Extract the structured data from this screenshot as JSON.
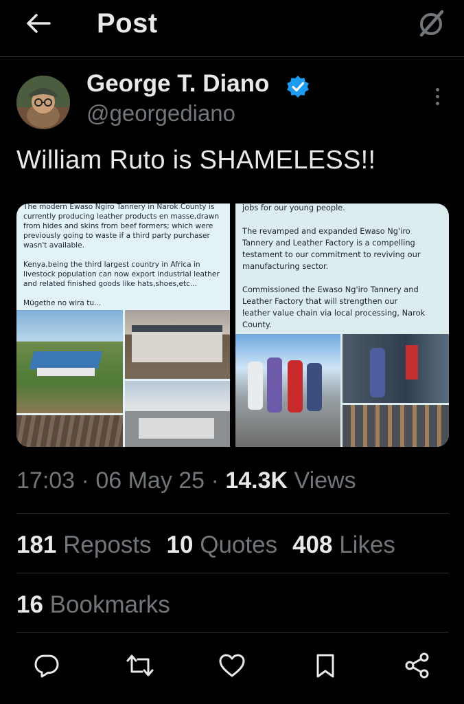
{
  "header": {
    "title": "Post"
  },
  "author": {
    "name": "George T. Diano",
    "handle": "@georgediano"
  },
  "tweet": {
    "text": "William Ruto is SHAMELESS!!"
  },
  "media": {
    "left_text": [
      "The modern Ewaso Ngiro Tannery in Narok County is",
      "currently producing leather products en masse,drawn",
      "from hides and skins from beef formers; which were",
      "previously going to waste if a third party purchaser",
      "wasn't available.",
      "",
      "Kenya,being the third largest country in Africa in",
      "livestock population can now export industrial leather",
      "and related finished goods like hats,shoes,etc...",
      "",
      "Mũgethe no wira tu..."
    ],
    "right_text": [
      "jobs for our young people.",
      "",
      "The revamped and expanded Ewaso Ng'iro",
      "Tannery and Leather Factory is a compelling",
      "testament to our commitment to reviving our",
      "manufacturing sector.",
      "",
      "Commissioned the Ewaso Ng'iro Tannery and",
      "Leather Factory that will strengthen our",
      "leather value chain via local processing, Narok",
      "County."
    ]
  },
  "meta": {
    "time": "17:03",
    "sep1": "·",
    "date": "06 May 25",
    "sep2": "·",
    "views_count": "14.3K",
    "views_label": "Views"
  },
  "stats": {
    "reposts_count": "181",
    "reposts_label": "Reposts",
    "quotes_count": "10",
    "quotes_label": "Quotes",
    "likes_count": "408",
    "likes_label": "Likes",
    "bookmarks_count": "16",
    "bookmarks_label": "Bookmarks"
  },
  "icons": {
    "back": "arrow-left-icon",
    "grok": "grok-icon",
    "verified": "verified-badge-icon",
    "more": "more-icon",
    "reply": "reply-icon",
    "repost": "repost-icon",
    "like": "heart-icon",
    "bookmark": "bookmark-icon",
    "share": "share-icon"
  },
  "colors": {
    "background": "#000000",
    "text": "#e7e9ea",
    "muted": "#71767b",
    "divider": "#2f3336",
    "verified": "#1d9bf0"
  }
}
